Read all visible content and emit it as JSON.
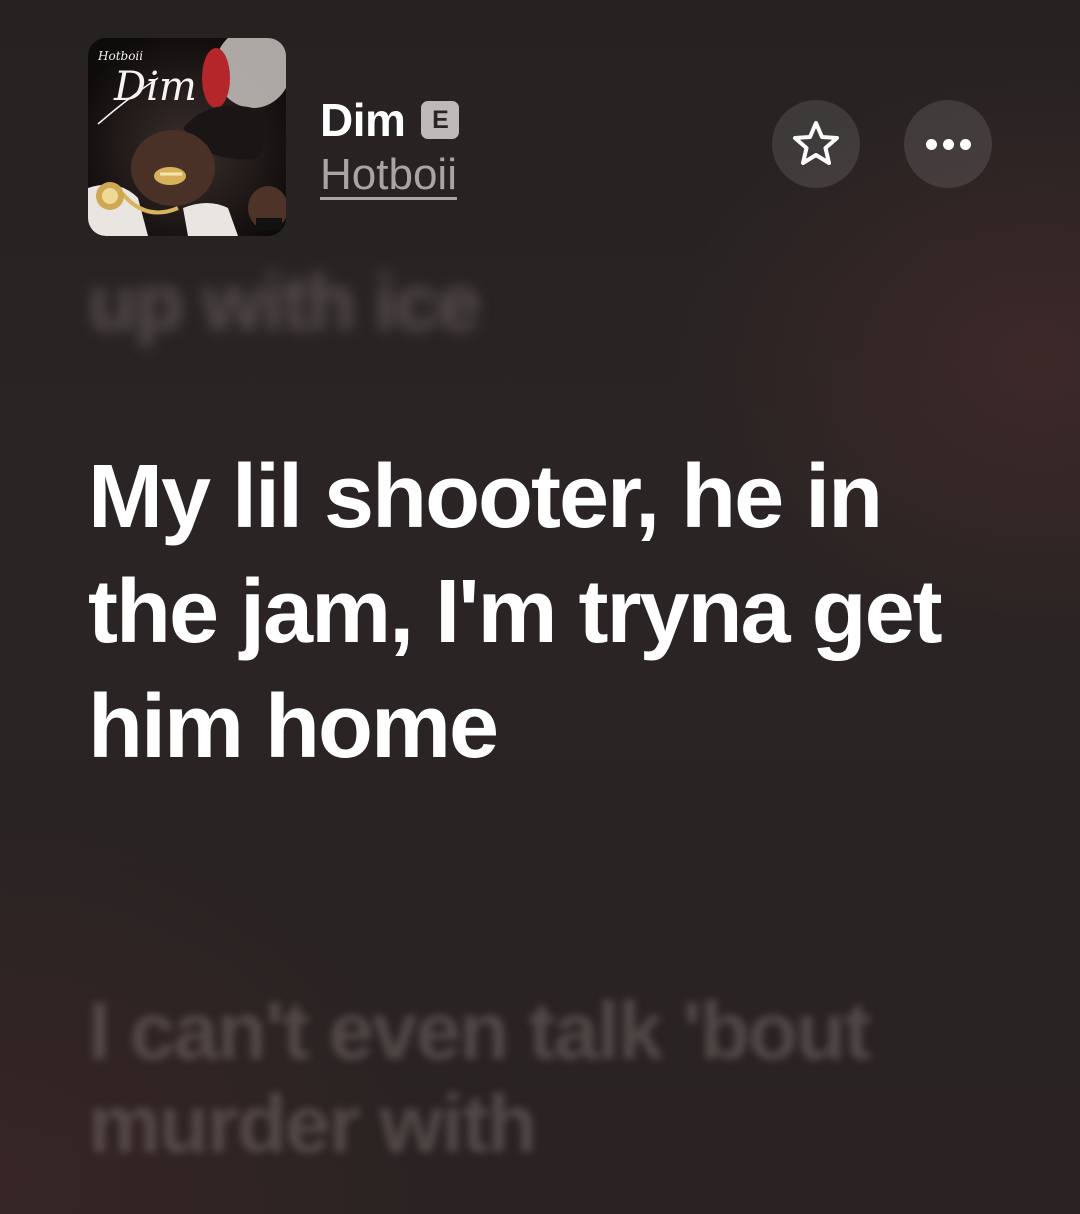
{
  "header": {
    "song_title": "Dim",
    "explicit_badge": "E",
    "artist": "Hotboii",
    "artwork": {
      "script_title": "Dim",
      "script_artist": "Hotboii"
    }
  },
  "actions": {
    "favorite_icon": "star-outline-icon",
    "more_icon": "ellipsis-icon"
  },
  "lyrics": {
    "previous": "up with ice",
    "current": "My lil shooter, he in the jam, I'm tryna get him home",
    "next": "I can't even talk 'bout murder with"
  },
  "colors": {
    "background": "#2a2424",
    "active_lyric": "#ffffff",
    "artist_link": "#aaa4a2",
    "explicit_badge": "#bdb9b8"
  }
}
